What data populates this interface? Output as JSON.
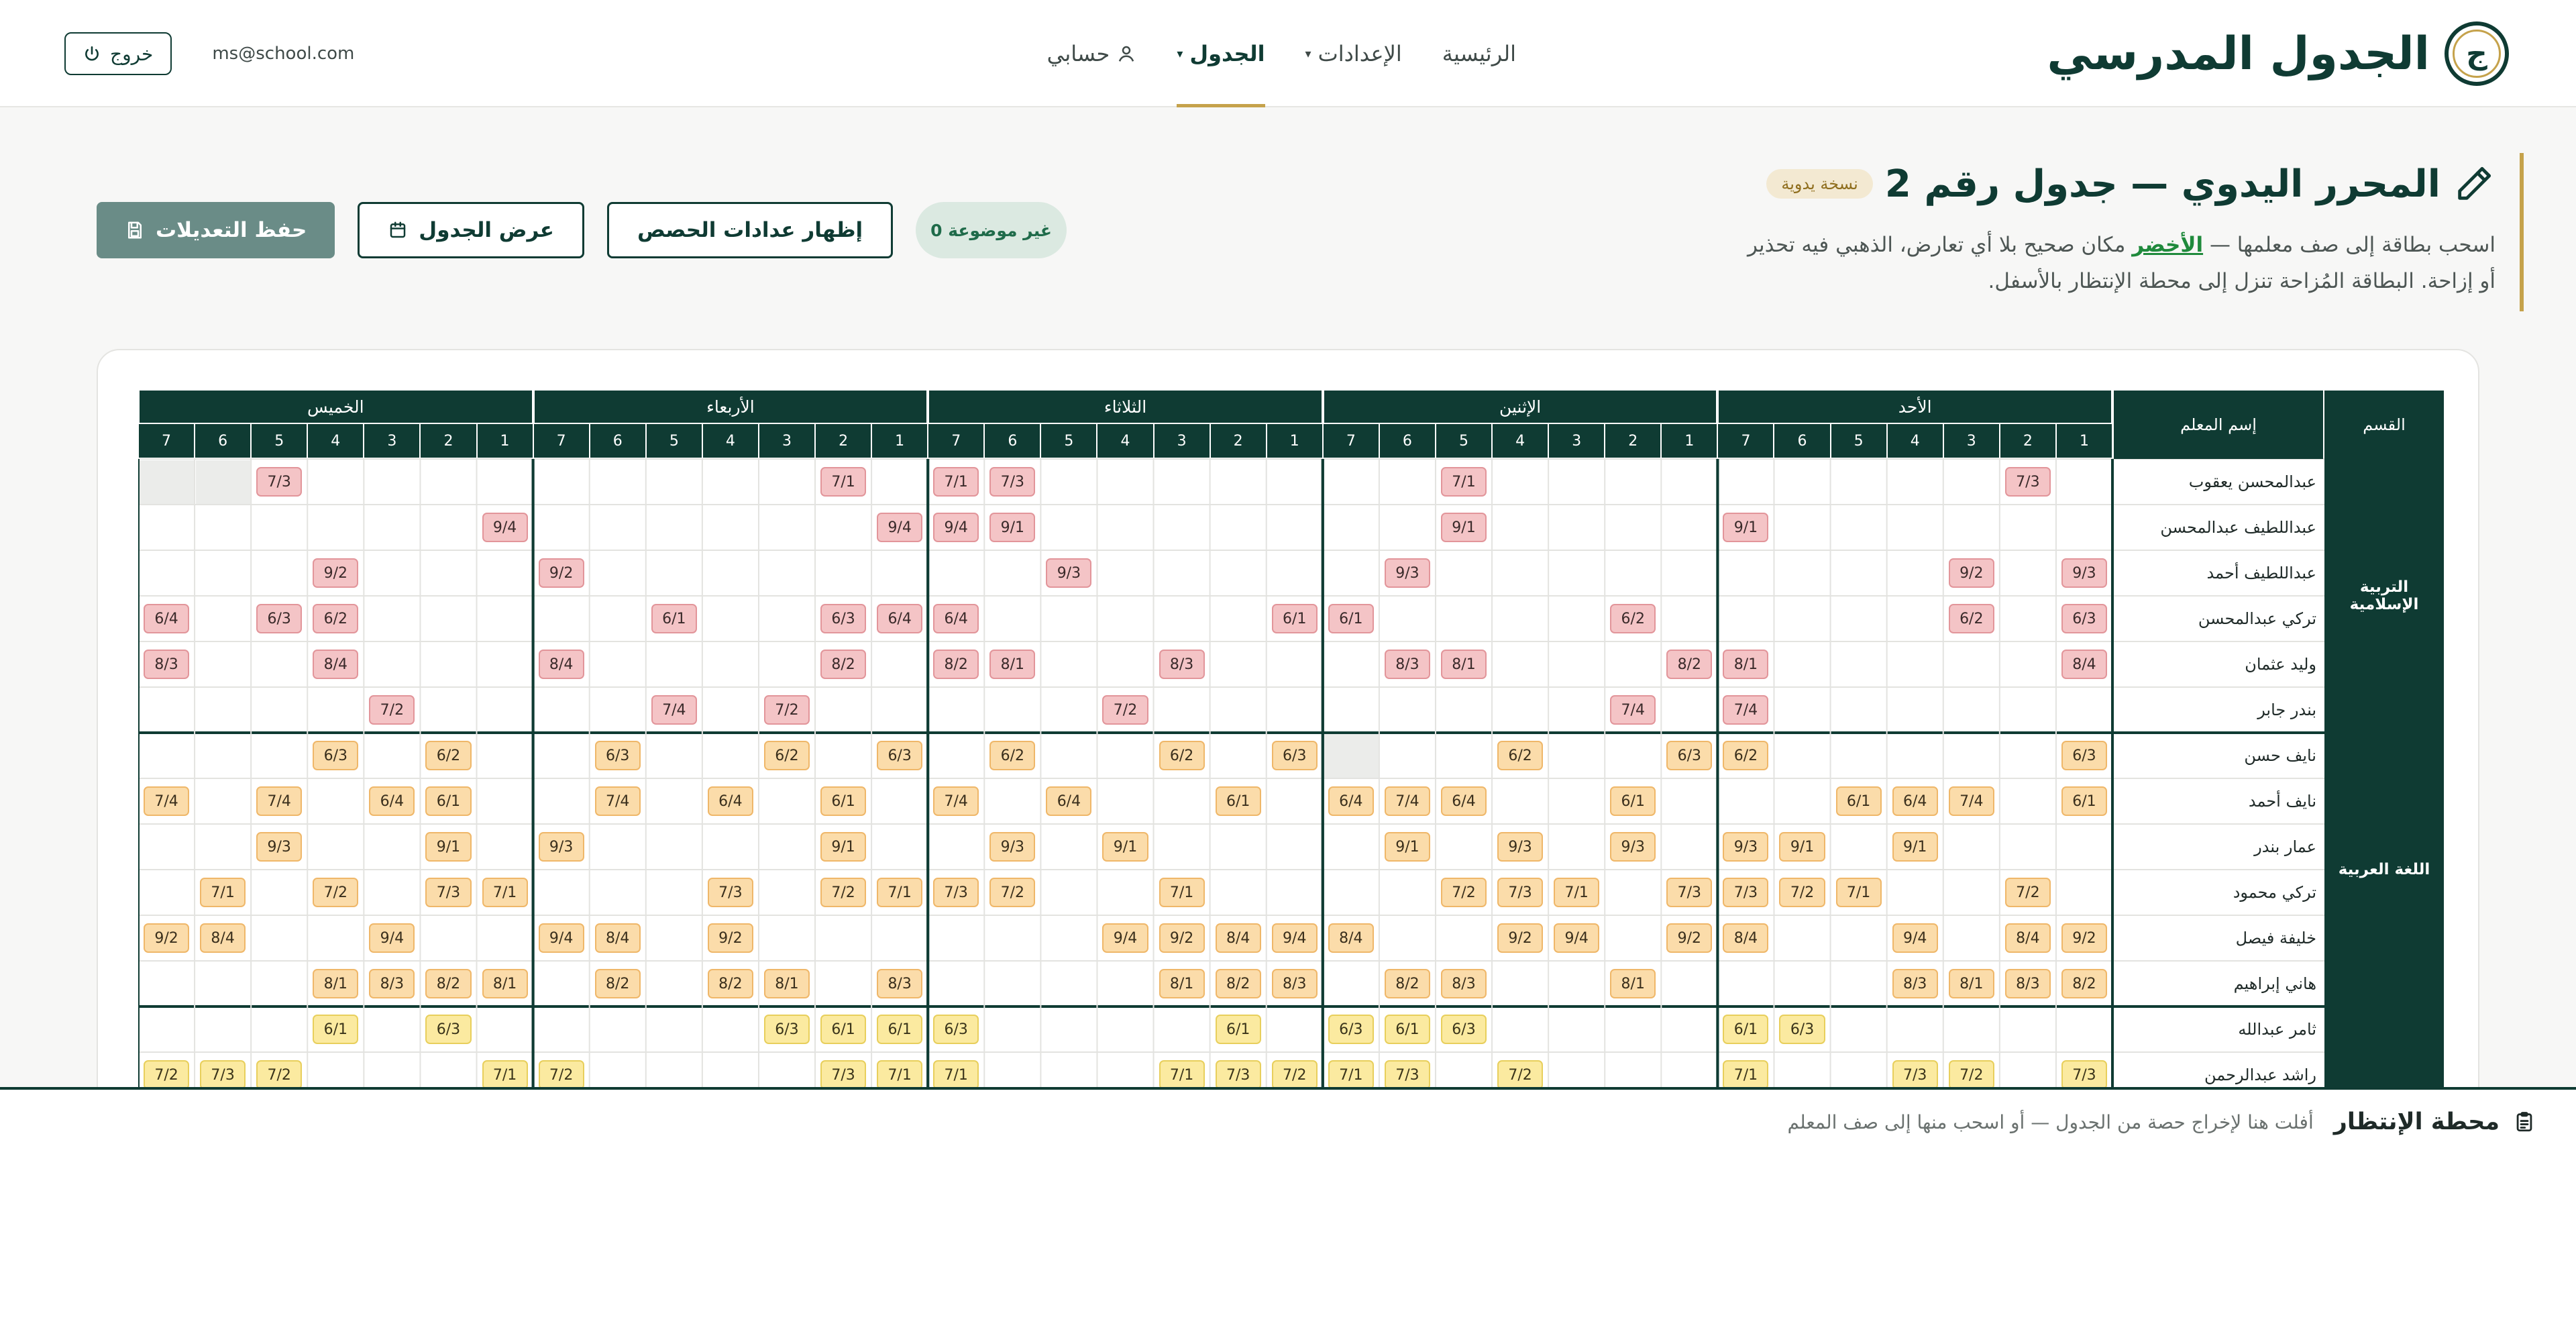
{
  "brand": {
    "name": "الجدول المدرسي",
    "logo_letter": "ج"
  },
  "nav": {
    "items": [
      {
        "label": "الرئيسية",
        "active": false,
        "dropdown": false
      },
      {
        "label": "الإعدادات",
        "active": false,
        "dropdown": true
      },
      {
        "label": "الجدول",
        "active": true,
        "dropdown": true
      },
      {
        "label": "حسابي",
        "active": false,
        "dropdown": false
      }
    ]
  },
  "user": {
    "email": "ms@school.com",
    "logout_label": "خروج"
  },
  "header": {
    "title": "المحرر اليدوي — جدول رقم 2",
    "badge": "نسخة يدوية",
    "instr_part1": "اسحب بطاقة إلى صف معلمها — ",
    "instr_green": "الأخضر",
    "instr_part2": " مكان صحيح بلا أي تعارض، الذهبي فيه تحذير",
    "instr_line2": "أو إزاحة. البطاقة المُزاحة تنزل إلى محطة الإنتظار بالأسفل."
  },
  "actions": {
    "unplaced_badge": "0 غير موضوعة",
    "show_counts": "إظهار عدادات الحصص",
    "view_schedule": "عرض الجدول",
    "save": "حفظ التعديلات"
  },
  "timetable": {
    "dept_header": "القسم",
    "teacher_header": "إسم المعلم",
    "days": [
      "الأحد",
      "الإثنين",
      "الثلاثاء",
      "الأربعاء",
      "الخميس"
    ],
    "periods": [
      "1",
      "2",
      "3",
      "4",
      "5",
      "6",
      "7"
    ],
    "departments": [
      {
        "name": "التربية الإسلامية",
        "rows": 6,
        "color": "red"
      },
      {
        "name": "اللغة العربية",
        "rows": 6,
        "color": "orange"
      },
      {
        "name": "",
        "rows": 2,
        "color": "yellow"
      }
    ],
    "teachers": [
      {
        "name": "عبدالمحسن يعقوب",
        "cells": [
          null,
          "7/3",
          null,
          null,
          null,
          null,
          null,
          null,
          null,
          null,
          null,
          "7/1",
          null,
          null,
          null,
          null,
          null,
          null,
          null,
          "7/3",
          "7/1",
          null,
          "7/1",
          null,
          null,
          null,
          null,
          null,
          null,
          null,
          null,
          null,
          "7/3",
          "X",
          "X"
        ]
      },
      {
        "name": "عبداللطيف عبدالمحسن",
        "cells": [
          null,
          null,
          null,
          null,
          null,
          null,
          "9/1",
          null,
          null,
          null,
          null,
          "9/1",
          null,
          null,
          null,
          null,
          null,
          null,
          null,
          "9/1",
          "9/4",
          "9/4",
          null,
          null,
          null,
          null,
          null,
          null,
          "9/4",
          null,
          null,
          null,
          null,
          null,
          null
        ]
      },
      {
        "name": "عبداللطيف أحمد",
        "cells": [
          "9/3",
          null,
          "9/2",
          null,
          null,
          null,
          null,
          null,
          null,
          null,
          null,
          null,
          "9/3",
          null,
          null,
          null,
          null,
          null,
          "9/3",
          null,
          null,
          null,
          null,
          null,
          null,
          null,
          null,
          "9/2",
          null,
          null,
          null,
          "9/2",
          null,
          null,
          null
        ]
      },
      {
        "name": "تركي عبدالمحسن",
        "cells": [
          "6/3",
          null,
          "6/2",
          null,
          null,
          null,
          null,
          null,
          "6/2",
          null,
          null,
          null,
          null,
          "6/1",
          "6/1",
          null,
          null,
          null,
          null,
          null,
          "6/4",
          "6/4",
          "6/3",
          null,
          null,
          "6/1",
          null,
          null,
          null,
          null,
          null,
          "6/2",
          "6/3",
          null,
          "6/4"
        ]
      },
      {
        "name": "وليد عثمان",
        "cells": [
          "8/4",
          null,
          null,
          null,
          null,
          null,
          "8/1",
          "8/2",
          null,
          null,
          null,
          "8/1",
          "8/3",
          null,
          null,
          null,
          "8/3",
          null,
          null,
          "8/1",
          "8/2",
          null,
          "8/2",
          null,
          null,
          null,
          null,
          "8/4",
          null,
          null,
          null,
          "8/4",
          null,
          null,
          "8/3"
        ]
      },
      {
        "name": "بندر جابر",
        "cells": [
          null,
          null,
          null,
          null,
          null,
          null,
          "7/4",
          null,
          "7/4",
          null,
          null,
          null,
          null,
          null,
          null,
          null,
          null,
          "7/2",
          null,
          null,
          null,
          null,
          null,
          "7/2",
          null,
          "7/4",
          null,
          null,
          null,
          null,
          "7/2",
          null,
          null,
          null,
          null
        ]
      },
      {
        "name": "نايف حسن",
        "cells": [
          "6/3",
          null,
          null,
          null,
          null,
          null,
          "6/2",
          "6/3",
          null,
          null,
          "6/2",
          null,
          null,
          "X",
          "6/3",
          null,
          "6/2",
          null,
          null,
          "6/2",
          null,
          "6/3",
          null,
          "6/2",
          null,
          null,
          "6/3",
          null,
          null,
          "6/2",
          null,
          "6/3",
          null,
          null,
          null
        ]
      },
      {
        "name": "نايف أحمد",
        "cells": [
          "6/1",
          null,
          "7/4",
          "6/4",
          "6/1",
          null,
          null,
          null,
          "6/1",
          null,
          null,
          "6/4",
          "7/4",
          "6/4",
          null,
          "6/1",
          null,
          null,
          "6/4",
          null,
          "7/4",
          null,
          "6/1",
          null,
          "6/4",
          null,
          "7/4",
          null,
          null,
          "6/1",
          "6/4",
          null,
          "7/4",
          null,
          "7/4"
        ]
      },
      {
        "name": "عمار بندر",
        "cells": [
          null,
          null,
          null,
          "9/1",
          null,
          "9/1",
          "9/3",
          null,
          "9/3",
          null,
          "9/3",
          null,
          "9/1",
          null,
          null,
          null,
          null,
          "9/1",
          null,
          "9/3",
          null,
          null,
          "9/1",
          null,
          null,
          null,
          null,
          "9/3",
          null,
          "9/1",
          null,
          null,
          "9/3",
          null,
          null
        ]
      },
      {
        "name": "تركي محمود",
        "cells": [
          null,
          "7/2",
          null,
          null,
          "7/1",
          "7/2",
          "7/3",
          "7/3",
          null,
          "7/1",
          "7/3",
          "7/2",
          null,
          null,
          null,
          null,
          "7/1",
          null,
          null,
          "7/2",
          "7/3",
          "7/1",
          "7/2",
          null,
          "7/3",
          null,
          null,
          null,
          "7/1",
          "7/3",
          null,
          "7/2",
          null,
          "7/1",
          null
        ]
      },
      {
        "name": "خليفة فيصل",
        "cells": [
          "9/2",
          "8/4",
          null,
          "9/4",
          null,
          null,
          "8/4",
          "9/2",
          null,
          "9/4",
          "9/2",
          null,
          null,
          "8/4",
          "9/4",
          "8/4",
          "9/2",
          "9/4",
          null,
          null,
          null,
          null,
          null,
          null,
          "9/2",
          null,
          "8/4",
          "9/4",
          null,
          null,
          "9/4",
          null,
          null,
          "8/4",
          "9/2"
        ]
      },
      {
        "name": "هاني إبراهيم",
        "cells": [
          "8/2",
          "8/3",
          "8/1",
          "8/3",
          null,
          null,
          null,
          null,
          "8/1",
          null,
          null,
          "8/3",
          "8/2",
          null,
          "8/3",
          "8/2",
          "8/1",
          null,
          null,
          null,
          null,
          "8/3",
          null,
          "8/1",
          "8/2",
          null,
          "8/2",
          null,
          "8/1",
          "8/2",
          "8/3",
          "8/1",
          null,
          null,
          null
        ]
      },
      {
        "name": "ثامر عبدالله",
        "cells": [
          null,
          null,
          null,
          null,
          null,
          "6/3",
          "6/1",
          null,
          null,
          null,
          null,
          "6/3",
          "6/1",
          "6/3",
          null,
          "6/1",
          null,
          null,
          null,
          null,
          "6/3",
          "6/1",
          "6/1",
          "6/3",
          null,
          null,
          null,
          null,
          null,
          "6/3",
          null,
          "6/1",
          null,
          null,
          null
        ]
      },
      {
        "name": "راشد عبدالرحمن",
        "cells": [
          "7/3",
          null,
          "7/2",
          "7/3",
          null,
          null,
          "7/1",
          null,
          null,
          null,
          "7/2",
          null,
          "7/3",
          "7/1",
          "7/2",
          "7/3",
          "7/1",
          null,
          null,
          null,
          "7/1",
          "7/1",
          "7/3",
          null,
          null,
          null,
          null,
          "7/2",
          "7/1",
          null,
          null,
          null,
          "7/2",
          "7/3",
          "7/2"
        ]
      }
    ]
  },
  "station": {
    "title": "محطة الإنتظار",
    "hint": "أفلت هنا لإخراج حصة من الجدول — أو اسحب منها إلى صف المعلم"
  },
  "colors": {
    "primary": "#0f3b33",
    "gold": "#c5a24b",
    "red_chip": "#f4c4c6",
    "orange_chip": "#fbdcaa",
    "yellow_chip": "#fbeaa0",
    "green": "#1f8a3c"
  }
}
